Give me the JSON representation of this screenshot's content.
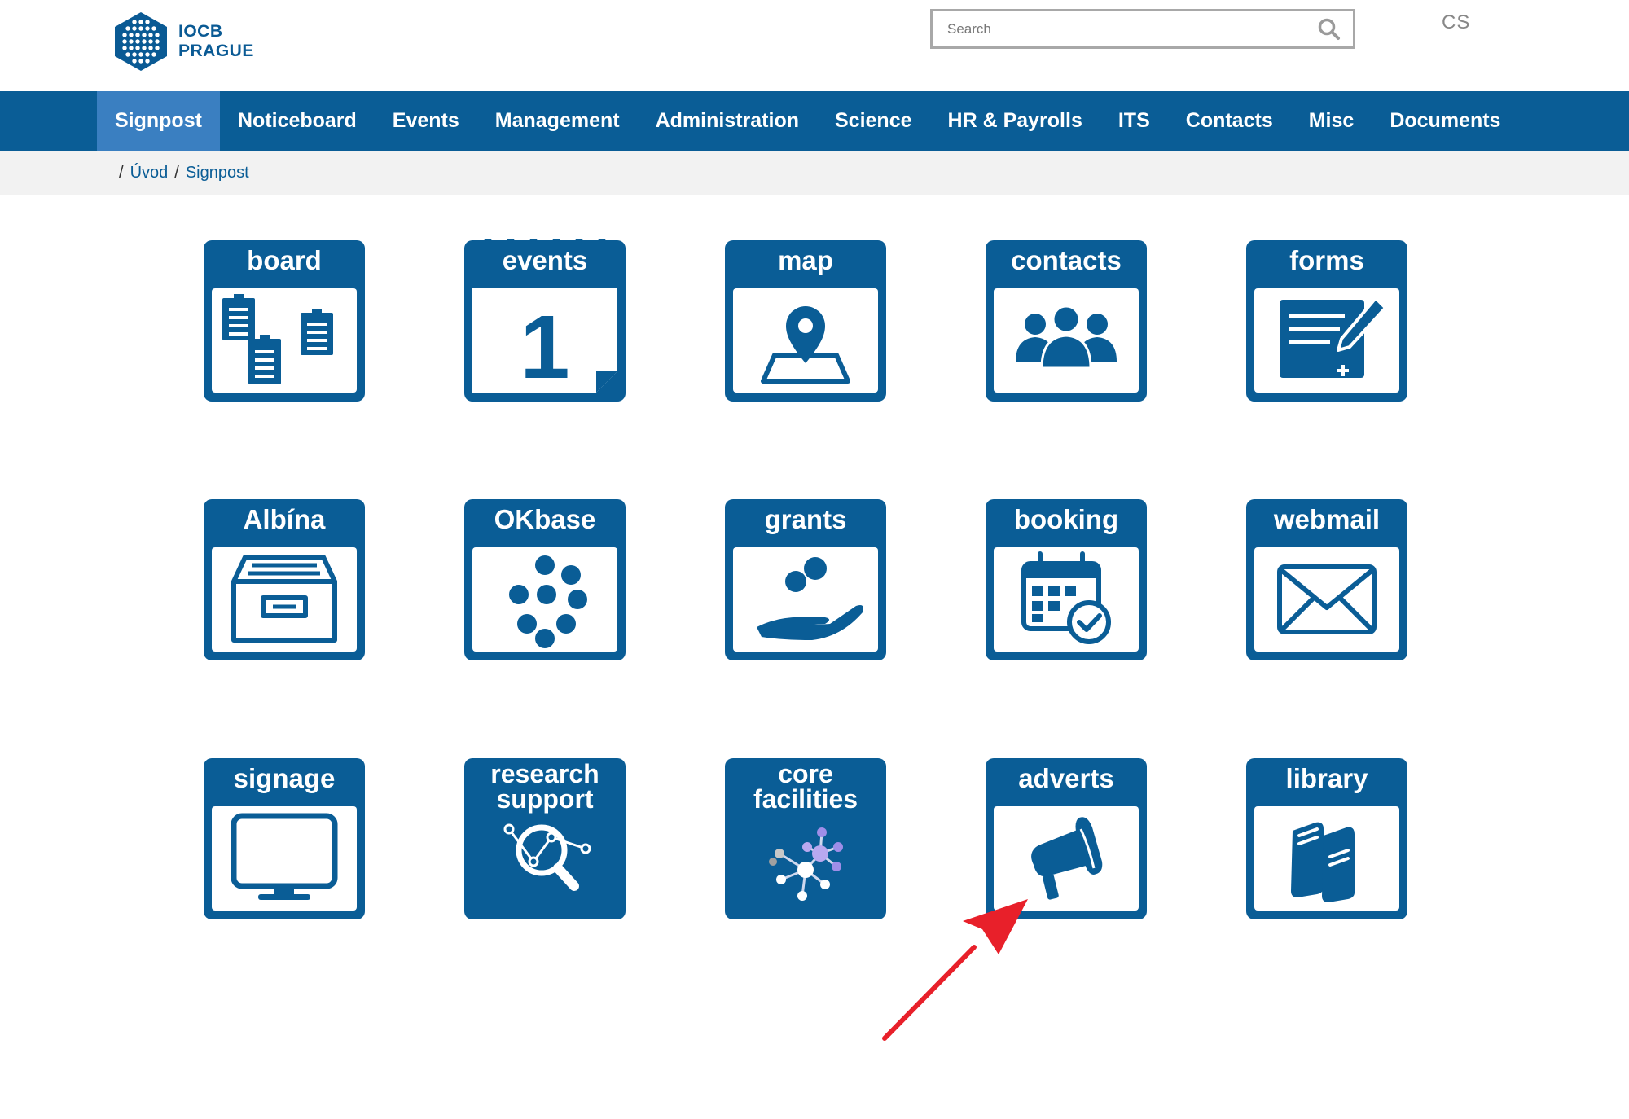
{
  "header": {
    "logo_line1": "IOCB",
    "logo_line2": "PRAGUE",
    "search_placeholder": "Search",
    "language": "CS"
  },
  "nav": {
    "items": [
      {
        "label": "Signpost",
        "active": true
      },
      {
        "label": "Noticeboard"
      },
      {
        "label": "Events"
      },
      {
        "label": "Management"
      },
      {
        "label": "Administration"
      },
      {
        "label": "Science"
      },
      {
        "label": "HR & Payrolls"
      },
      {
        "label": "ITS"
      },
      {
        "label": "Contacts"
      },
      {
        "label": "Misc"
      },
      {
        "label": "Documents"
      }
    ]
  },
  "breadcrumb": {
    "sep": "/",
    "items": [
      "Úvod",
      "Signpost"
    ]
  },
  "tiles": [
    {
      "label": "board",
      "icon": "clipboards-icon"
    },
    {
      "label": "events",
      "icon": "calendar-day-icon",
      "day": "1"
    },
    {
      "label": "map",
      "icon": "map-pin-icon"
    },
    {
      "label": "contacts",
      "icon": "people-group-icon"
    },
    {
      "label": "forms",
      "icon": "form-edit-icon"
    },
    {
      "label": "Albína",
      "icon": "archive-drawer-icon"
    },
    {
      "label": "OKbase",
      "icon": "dots-cluster-icon"
    },
    {
      "label": "grants",
      "icon": "hand-coins-icon"
    },
    {
      "label": "booking",
      "icon": "calendar-check-icon"
    },
    {
      "label": "webmail",
      "icon": "envelope-icon"
    },
    {
      "label": "signage",
      "icon": "monitor-icon"
    },
    {
      "label_line1": "research",
      "label_line2": "support",
      "icon": "magnifier-chart-icon"
    },
    {
      "label_line1": "core",
      "label_line2": "facilities",
      "icon": "molecule-network-icon"
    },
    {
      "label": "adverts",
      "icon": "megaphone-icon"
    },
    {
      "label": "library",
      "icon": "books-icon"
    }
  ],
  "colors": {
    "brand_blue": "#0a5d96",
    "nav_active": "#3a7fc1",
    "annotation_arrow": "#e8202a"
  }
}
